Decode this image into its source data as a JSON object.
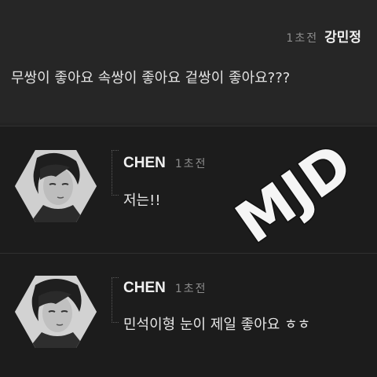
{
  "top_comment": {
    "author": "강민정",
    "time": "1초전",
    "text": "무쌍이 좋아요 속쌍이 좋아요 겉쌍이 좋아요???"
  },
  "replies": [
    {
      "author": "CHEN",
      "time": "1초전",
      "text": "저는!!"
    },
    {
      "author": "CHEN",
      "time": "1초전",
      "text": "민석이형 눈이 제일 좋아요 ㅎㅎ"
    }
  ],
  "watermark": {
    "text": "MJD"
  }
}
